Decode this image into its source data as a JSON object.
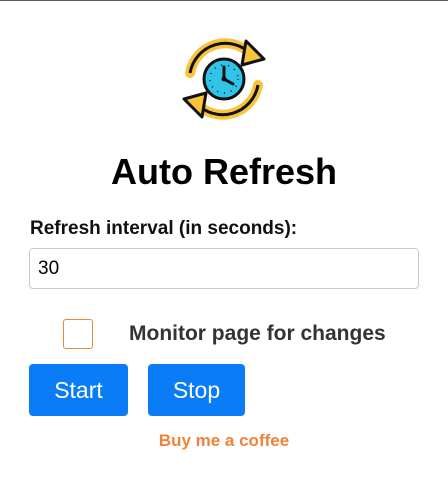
{
  "app": {
    "title": "Auto Refresh",
    "logo_icon": "clock-refresh-icon"
  },
  "interval": {
    "label": "Refresh interval (in seconds):",
    "value": "30"
  },
  "monitor": {
    "label": "Monitor page for changes",
    "checked": false
  },
  "buttons": {
    "start_label": "Start",
    "stop_label": "Stop"
  },
  "footer": {
    "coffee_link": "Buy me a coffee"
  },
  "colors": {
    "primary_button": "#0a7cf5",
    "accent_orange": "#f0823a",
    "icon_yellow": "#f9c43a",
    "icon_clock_face": "#2fc4e8"
  }
}
